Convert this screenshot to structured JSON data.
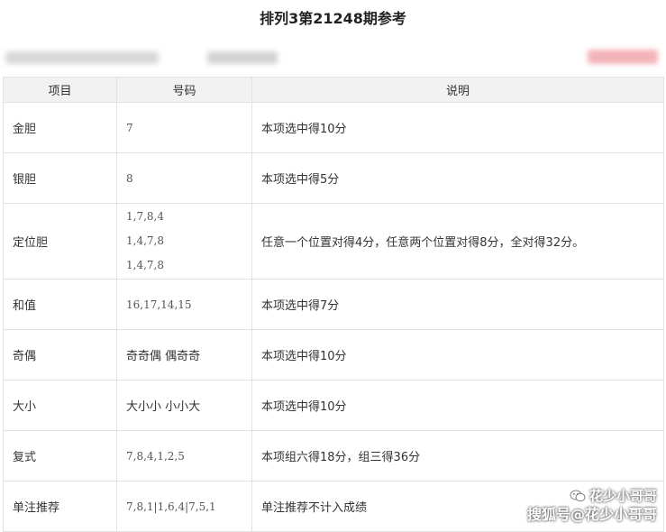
{
  "title": "排列3第21248期参考",
  "table": {
    "headers": [
      "项目",
      "号码",
      "说明"
    ],
    "rows": [
      {
        "item": "金胆",
        "numbers": [
          "7"
        ],
        "note": "本项选中得10分"
      },
      {
        "item": "银胆",
        "numbers": [
          "8"
        ],
        "note": "本项选中得5分"
      },
      {
        "item": "定位胆",
        "numbers": [
          "1,7,8,4",
          "1,4,7,8",
          "1,4,7,8"
        ],
        "note": "任意一个位置对得4分，任意两个位置对得8分，全对得32分。"
      },
      {
        "item": "和值",
        "numbers": [
          "16,17,14,15"
        ],
        "note": "本项选中得7分"
      },
      {
        "item": "奇偶",
        "numbers": [
          "奇奇偶 偶奇奇"
        ],
        "note": "本项选中得10分"
      },
      {
        "item": "大小",
        "numbers": [
          "大小小 小小大"
        ],
        "note": "本项选中得10分"
      },
      {
        "item": "复式",
        "numbers": [
          "7,8,4,1,2,5"
        ],
        "note": "本项组六得18分，组三得36分"
      },
      {
        "item": "单注推荐",
        "numbers": [
          "7,8,1|1,6,4|7,5,1"
        ],
        "note": "单注推荐不计入成绩"
      }
    ]
  },
  "watermark": {
    "top": "花少小哥哥",
    "bottom": "搜狐号@花少小哥哥",
    "icon": "wechat-icon"
  }
}
